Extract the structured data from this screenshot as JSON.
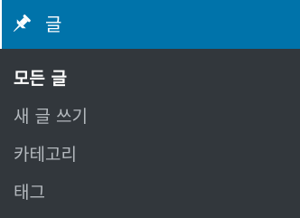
{
  "menu": {
    "header": {
      "label": "글",
      "icon": "pin-icon",
      "background": "#0073aa",
      "text_color": "#ffffff"
    },
    "items": [
      {
        "label": "모든 글",
        "current": true
      },
      {
        "label": "새 글 쓰기",
        "current": false
      },
      {
        "label": "카테고리",
        "current": false
      },
      {
        "label": "태그",
        "current": false
      }
    ],
    "background": "#32373c",
    "item_color": "#b4b9be",
    "current_item_color": "#ffffff"
  }
}
